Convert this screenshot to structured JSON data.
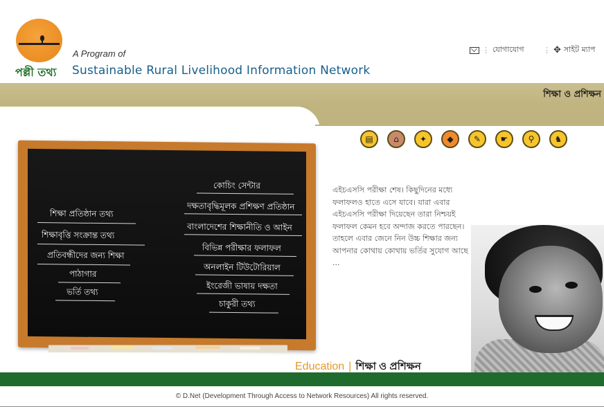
{
  "logo": {
    "bengali_name": "পল্লী তথ্য"
  },
  "header": {
    "program_label": "A Program of",
    "network_name": "Sustainable Rural Livelihood Information Network",
    "links": [
      {
        "label": "যোগাযোগ",
        "icon": "mail-icon"
      },
      {
        "label": "সাইট ম্যাপ",
        "icon": "sitemap-icon"
      }
    ]
  },
  "section_title": "শিক্ষা ও প্রশিক্ষন",
  "category_icons": [
    "book-icon",
    "house-icon",
    "runner-icon",
    "map-icon",
    "pen-icon",
    "hand-icon",
    "magnifier-icon",
    "elephant-icon"
  ],
  "chalkboard": {
    "left_items": [
      "শিক্ষা প্রতিষ্ঠান তথ্য",
      "শিক্ষাবৃত্তি সংক্রান্ত তথ্য",
      "প্রতিবন্ধীদের জন্য শিক্ষা",
      "পাঠাগার",
      "ভর্তি তথ্য"
    ],
    "right_items": [
      "কোচিং সেন্টার",
      "দক্ষতাবৃদ্ধিমূলক প্রশিক্ষণ প্রতিষ্ঠান",
      "বাংলাদেশের শিক্ষানীতি ও আইন",
      "বিভিন্ন পরীক্ষার ফলাফল",
      "অনলাইন টিউটোরিয়াল",
      "ইংরেজী ভাষায় দক্ষতা",
      "চাকুরী তথ্য"
    ]
  },
  "article": {
    "text": "এইচএসসি পরীক্ষা শেষ। কিছুদিনের মধ্যে ফলাফলও হাতে এসে যাবে। যারা এবার এইচএসসি পরীক্ষা দিয়েছেন তারা নিশ্চয়ই ফলাফল কেমন হবে অন্দাজ করতে পারছেন। তাহলে এবার জেনে নিন উচ্চ শিক্ষার জন্য আপনার কোথায় কোথায় ভর্তির সুযোগ আছে ..."
  },
  "caption": {
    "english": "Education",
    "separator": "|",
    "bengali": "শিক্ষা ও প্রশিক্ষন"
  },
  "footer": "© D.Net (Development Through Access to Network Resources) All rights reserved."
}
